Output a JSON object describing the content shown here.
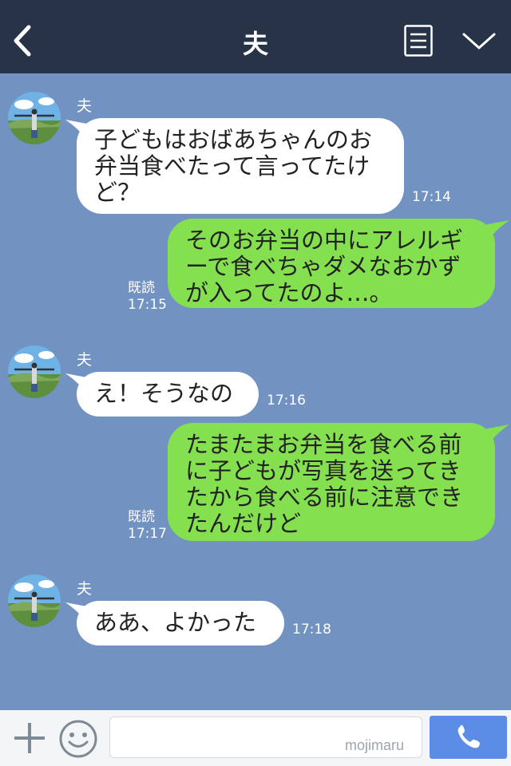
{
  "header": {
    "title": "夫",
    "icons": {
      "back": "chevron-left-icon",
      "menu": "note-list-icon",
      "dropdown": "chevron-down-icon"
    }
  },
  "chat": {
    "messages": [
      {
        "side": "in",
        "sender": "夫",
        "lines": [
          "子どもはおばあちゃんのお",
          "弁当食べたって言ってたけ",
          "ど？"
        ],
        "time": "17:14"
      },
      {
        "side": "out",
        "read": "既読",
        "lines": [
          "そのお弁当の中にアレルギ",
          "ーで食べちゃダメなおかず",
          "が入ってたのよ…。"
        ],
        "time": "17:15"
      },
      {
        "side": "in",
        "sender": "夫",
        "lines": [
          "え！そうなの"
        ],
        "time": "17:16"
      },
      {
        "side": "out",
        "read": "既読",
        "lines": [
          "たまたまお弁当を食べる前",
          "に子どもが写真を送ってき",
          "たから食べる前に注意でき",
          "たんだけど"
        ],
        "time": "17:17"
      },
      {
        "side": "in",
        "sender": "夫",
        "lines": [
          "ああ、よかった"
        ],
        "time": "17:18"
      }
    ]
  },
  "footer": {
    "input_value": "",
    "watermark": "mojimaru",
    "icons": {
      "plus": "plus-icon",
      "emoji": "smiley-icon",
      "call": "phone-icon"
    }
  },
  "colors": {
    "header_bg": "#273347",
    "chat_bg": "#7293c2",
    "incoming_bubble": "#ffffff",
    "outgoing_bubble": "#84e04e",
    "call_button": "#5b8de6",
    "footer_bg": "#f4f5f7"
  }
}
